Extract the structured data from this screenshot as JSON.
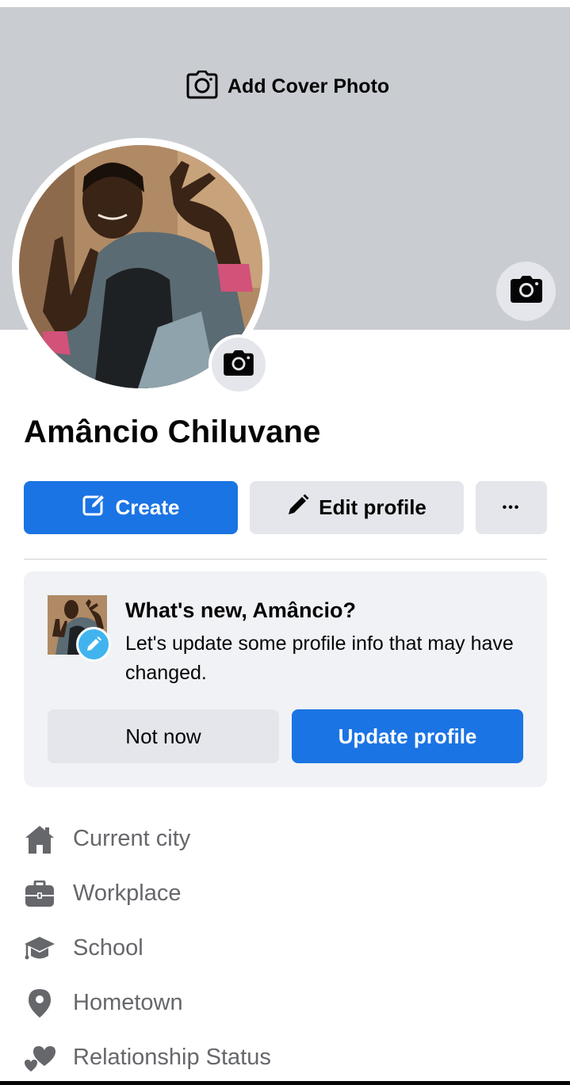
{
  "cover": {
    "add_cover_label": "Add Cover Photo"
  },
  "profile": {
    "name": "Amâncio Chiluvane"
  },
  "actions": {
    "create_label": "Create",
    "edit_label": "Edit profile",
    "more_label": "•••"
  },
  "update_card": {
    "title": "What's new, Amâncio?",
    "body": "Let's update some profile info that may have changed.",
    "not_now_label": "Not now",
    "update_label": "Update profile"
  },
  "info_items": [
    {
      "label": "Current city",
      "icon": "home-icon"
    },
    {
      "label": "Workplace",
      "icon": "briefcase-icon"
    },
    {
      "label": "School",
      "icon": "graduation-cap-icon"
    },
    {
      "label": "Hometown",
      "icon": "location-pin-icon"
    },
    {
      "label": "Relationship Status",
      "icon": "hearts-icon"
    }
  ],
  "colors": {
    "accent": "#1b74e4",
    "cover_bg": "#c9ccd1",
    "secondary_button": "#e4e6eb",
    "card_bg": "#f0f2f5",
    "muted_text": "#65676b"
  }
}
